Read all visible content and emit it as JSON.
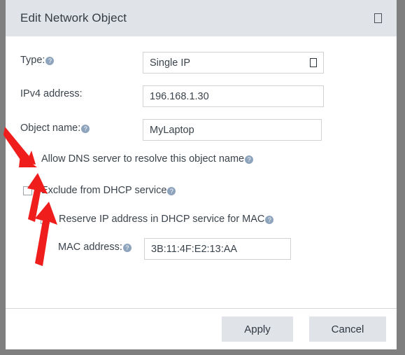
{
  "window": {
    "title": "Edit Network Object",
    "close_icon": "box-glyph-close-icon"
  },
  "form": {
    "type_row": {
      "label": "Type:",
      "help": "?",
      "value": "Single IP",
      "dropdown_icon": "box-glyph-dropdown-icon"
    },
    "ipv4_row": {
      "label": "IPv4 address:",
      "value": "196.168.1.30"
    },
    "object_name_row": {
      "label": "Object name:",
      "help": "?",
      "value": "MyLaptop"
    },
    "allow_dns_row": {
      "label": "Allow DNS server to resolve this object name",
      "help": "?",
      "checked": false
    },
    "exclude_dhcp_row": {
      "label": "Exclude from DHCP service",
      "help": "?",
      "checked": false
    },
    "reserve_ip_row": {
      "label": "Reserve IP address in DHCP service for MAC",
      "help": "?",
      "checked": false
    },
    "mac_row": {
      "label": "MAC address:",
      "help": "?",
      "value": "3B:11:4F:E2:13:AA"
    }
  },
  "footer": {
    "apply_label": "Apply",
    "cancel_label": "Cancel"
  },
  "colors": {
    "titlebar": "#e0e3e7",
    "frame": "#7f7f7f",
    "text": "#3b434c",
    "help_icon": "#8ea4bd",
    "annotation_arrow": "#f01d1d",
    "button": "#e0e3e7"
  },
  "annotations": {
    "arrow_1_target": "allow-dns-checkbox",
    "arrow_2_target": "exclude-dhcp-checkbox",
    "arrow_3_target": "reserve-ip-checkbox"
  }
}
